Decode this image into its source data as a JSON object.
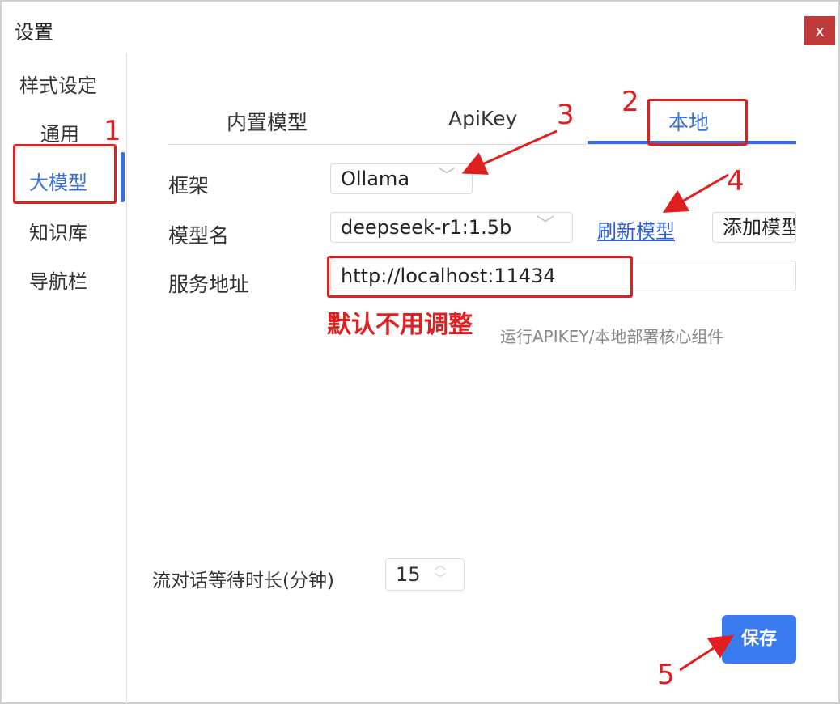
{
  "window": {
    "title": "设置",
    "close_label": "x"
  },
  "sidebar": {
    "items": [
      {
        "label": "样式设定"
      },
      {
        "label": "通用"
      },
      {
        "label": "大模型"
      },
      {
        "label": "知识库"
      },
      {
        "label": "导航栏"
      }
    ],
    "active_index": 2
  },
  "tabs": [
    {
      "label": "内置模型"
    },
    {
      "label": "ApiKey"
    },
    {
      "label": "本地"
    }
  ],
  "form": {
    "framework_label": "框架",
    "framework_value": "Ollama",
    "model_label": "模型名",
    "model_value": "deepseek-r1:1.5b",
    "refresh_link": "刷新模型",
    "add_model_button": "添加模型",
    "service_label": "服务地址",
    "service_value": "http://localhost:11434",
    "service_hint": "运行APIKEY/本地部署核心组件",
    "wait_label": "流对话等待时长(分钟)",
    "wait_value": "15",
    "save_button": "保存"
  },
  "annotations": {
    "note": "默认不用调整",
    "markers": [
      "1",
      "2",
      "3",
      "4",
      "5"
    ],
    "color": "#e02020"
  },
  "colors": {
    "accent": "#3a6fd8",
    "save": "#3a7bf0",
    "close": "#c0393b"
  }
}
